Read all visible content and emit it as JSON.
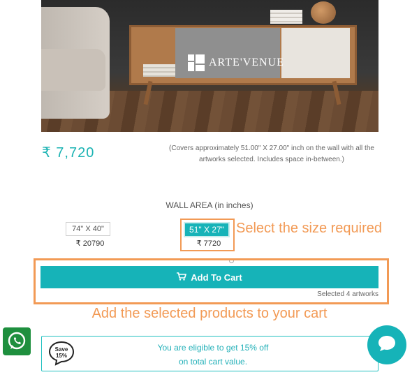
{
  "hero": {
    "logo_text": "ARTE'VENUE"
  },
  "product": {
    "price": "₹ 7,720",
    "coverage_note": "(Covers approximately 51.00\" X 27.00\" inch on the wall with all the artworks selected. Includes space in-between.)"
  },
  "wall_area": {
    "title": "WALL AREA (in inches)",
    "options": [
      {
        "label": "74\" X 40\"",
        "price": "₹ 20790",
        "selected": false
      },
      {
        "label": "51\" X 27\"",
        "price": "₹ 7720",
        "selected": true
      }
    ]
  },
  "annotations": {
    "select_size": "Select the size required",
    "add_to_cart": "Add the selected products to your cart"
  },
  "cart": {
    "button_label": "Add To Cart",
    "button_icon": "cart-icon",
    "selected_count": "Selected 4 artworks"
  },
  "offer": {
    "badge_line1": "Save",
    "badge_line2": "15%",
    "line1": "You are eligible to get 15% off",
    "line2": "on total cart value."
  },
  "colors": {
    "accent": "#16b3b8",
    "annotation": "#f29a55",
    "whatsapp": "#1e8f3e"
  }
}
